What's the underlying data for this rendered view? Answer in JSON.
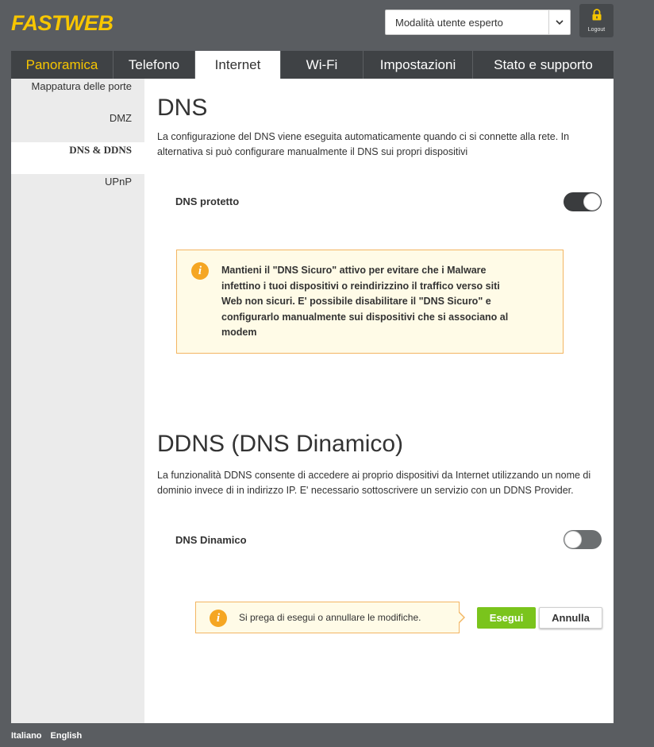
{
  "header": {
    "logo_text": "FASTWEB",
    "mode_select_value": "Modalità utente esperto",
    "logout_label": "Logout"
  },
  "tabs": [
    {
      "label": "Panoramica"
    },
    {
      "label": "Telefono"
    },
    {
      "label": "Internet"
    },
    {
      "label": "Wi-Fi"
    },
    {
      "label": "Impostazioni"
    },
    {
      "label": "Stato e supporto"
    }
  ],
  "active_tab": "Internet",
  "sidebar": {
    "items": [
      {
        "label": "Mappatura delle porte"
      },
      {
        "label": "DMZ"
      },
      {
        "label": "DNS & DDNS"
      },
      {
        "label": "UPnP"
      }
    ],
    "active_item": "DNS & DDNS"
  },
  "dns": {
    "title": "DNS",
    "description": "La configurazione del DNS viene eseguita automaticamente quando ci si connette alla rete. In alternativa si può configurare manualmente il DNS sui propri dispositivi",
    "toggle_label": "DNS protetto",
    "toggle_state": "on",
    "warning_text": "Mantieni il \"DNS Sicuro\" attivo per evitare che i Malware infettino i tuoi dispositivi o reindirizzino il traffico verso siti Web non sicuri. E' possibile disabilitare il \"DNS Sicuro\" e configurarlo manualmente sui dispositivi che si associano al modem"
  },
  "ddns": {
    "title": "DDNS (DNS Dinamico)",
    "description": "La funzionalità DDNS consente di accedere ai proprio dispositivi da Internet utilizzando un nome di dominio invece di in indirizzo IP. E' necessario sottoscrivere un servizio con un DDNS Provider.",
    "toggle_label": "DNS Dinamico",
    "toggle_state": "off"
  },
  "notice": {
    "text": "Si prega di esegui o annullare le modifiche.",
    "apply_label": "Esegui",
    "cancel_label": "Annulla"
  },
  "footer": {
    "languages": [
      "Italiano",
      "English"
    ]
  },
  "colors": {
    "brand_yellow": "#f7c600",
    "tab_bg": "#3f4245",
    "page_bg": "#5a5d61",
    "warning_border": "#f3b562",
    "warning_bg": "#fffbe7",
    "info_icon": "#f5a623",
    "apply_green": "#7ac41c"
  }
}
